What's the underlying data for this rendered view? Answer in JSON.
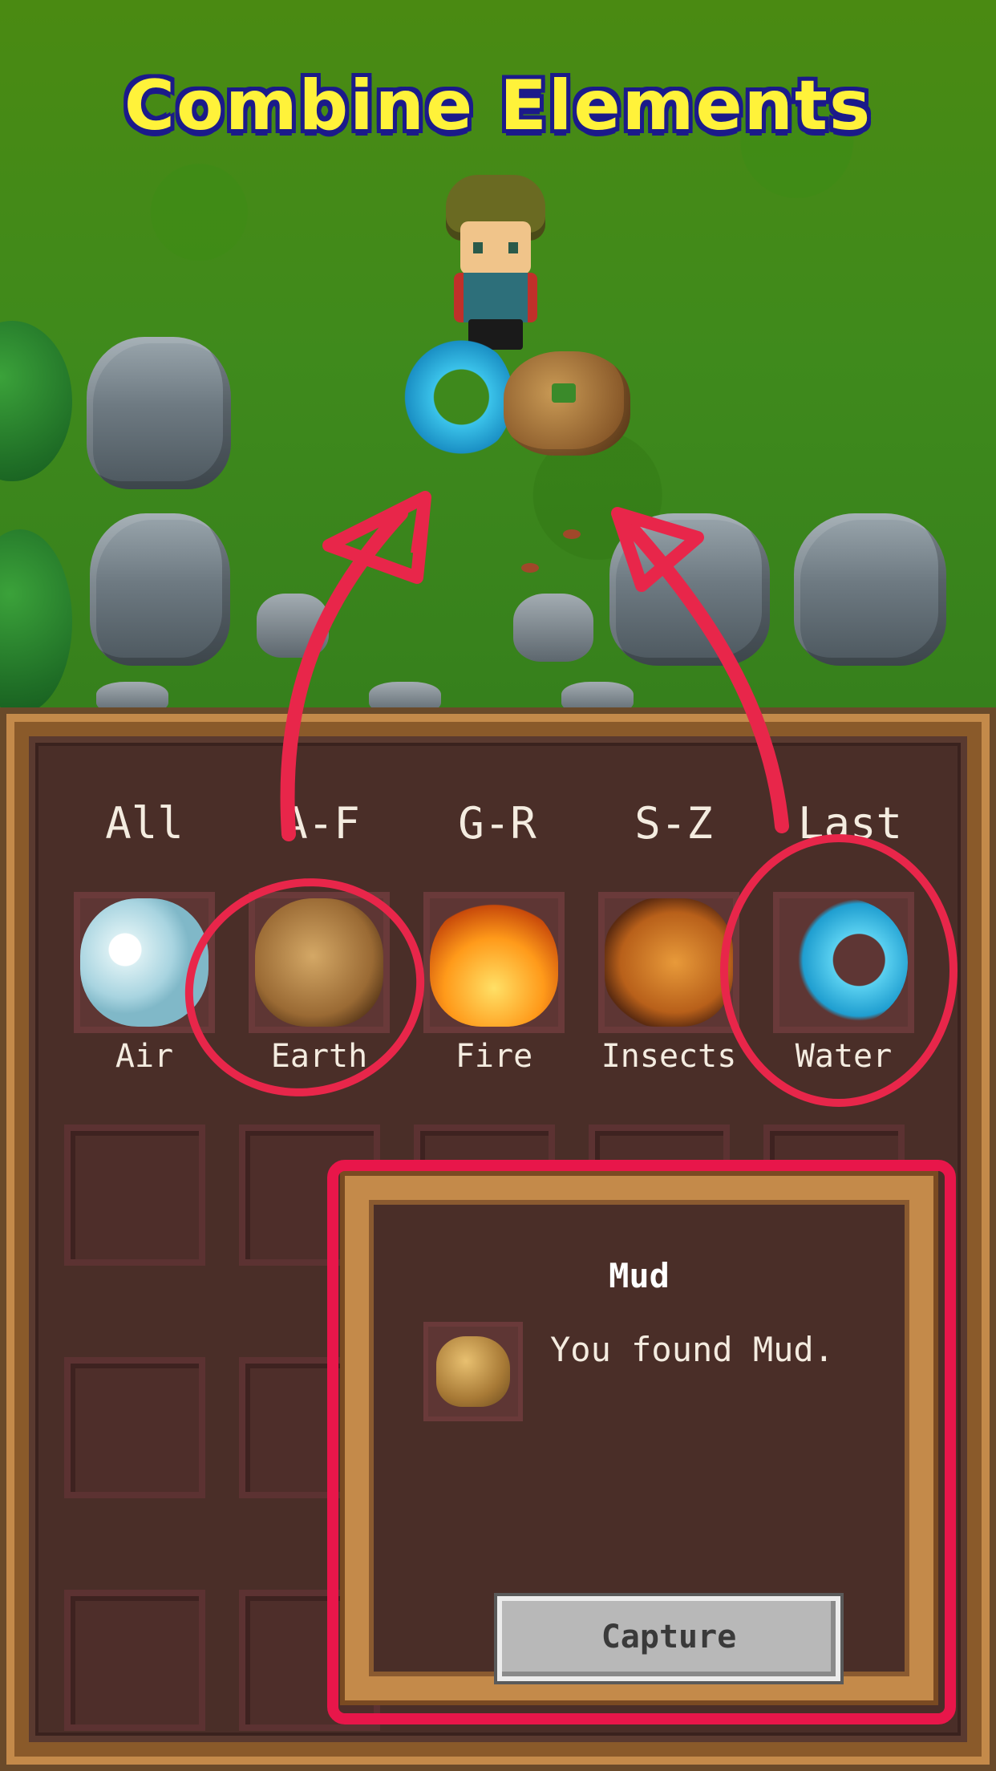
{
  "title": "Combine Elements",
  "tabs": [
    "All",
    "A-F",
    "G-R",
    "S-Z",
    "Last"
  ],
  "elements": [
    {
      "name": "Air",
      "icon": "air-cloud-icon"
    },
    {
      "name": "Earth",
      "icon": "earth-rock-icon"
    },
    {
      "name": "Fire",
      "icon": "fire-flame-icon"
    },
    {
      "name": "Insects",
      "icon": "insect-beetle-icon"
    },
    {
      "name": "Water",
      "icon": "water-wave-icon"
    }
  ],
  "popup": {
    "item_name": "Mud",
    "message": "You found Mud.",
    "item_icon": "mud-icon",
    "capture_label": "Capture"
  },
  "colors": {
    "annotation": "#e8264a",
    "title_text": "#fff23a",
    "title_outline": "#1b1a8a"
  }
}
